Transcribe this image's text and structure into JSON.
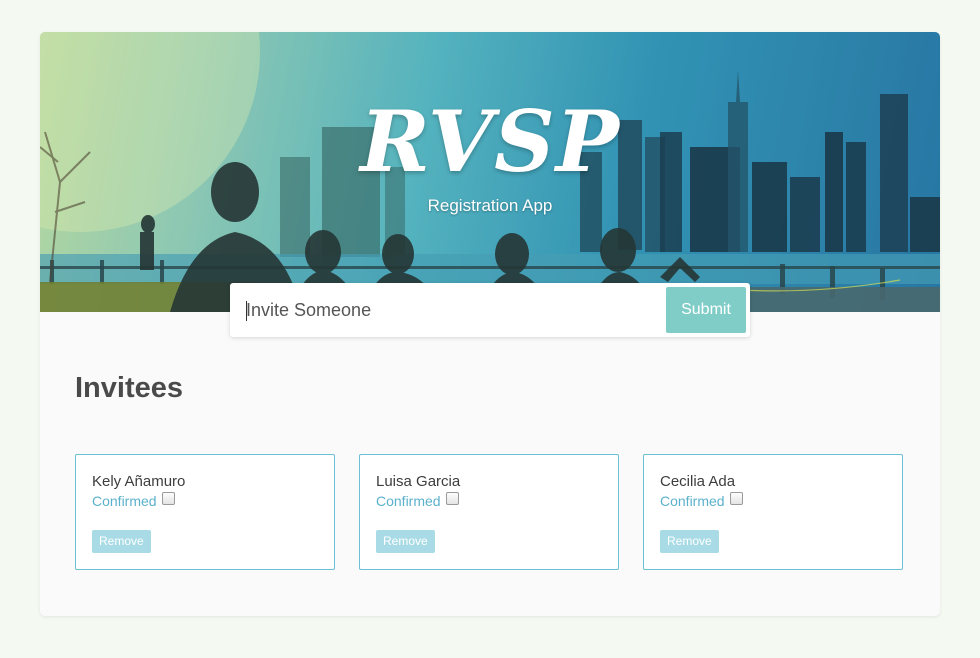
{
  "app": {
    "title": "RVSP",
    "subtitle": "Registration App"
  },
  "form": {
    "placeholder": "Invite Someone",
    "value": "",
    "submit_label": "Submit"
  },
  "invitees": {
    "heading": "Invitees",
    "items": [
      {
        "name": "Kely Añamuro",
        "status_label": "Confirmed",
        "confirmed": false,
        "remove_label": "Remove"
      },
      {
        "name": "Luisa Garcia",
        "status_label": "Confirmed",
        "confirmed": false,
        "remove_label": "Remove"
      },
      {
        "name": "Cecilia Ada",
        "status_label": "Confirmed",
        "confirmed": false,
        "remove_label": "Remove"
      }
    ]
  },
  "colors": {
    "page_background": "#f4f9f1",
    "accent": "#80cdc8",
    "card_border": "#6cc0d4",
    "status_text": "#5bb1cc",
    "remove_button": "#a8dbe5"
  }
}
